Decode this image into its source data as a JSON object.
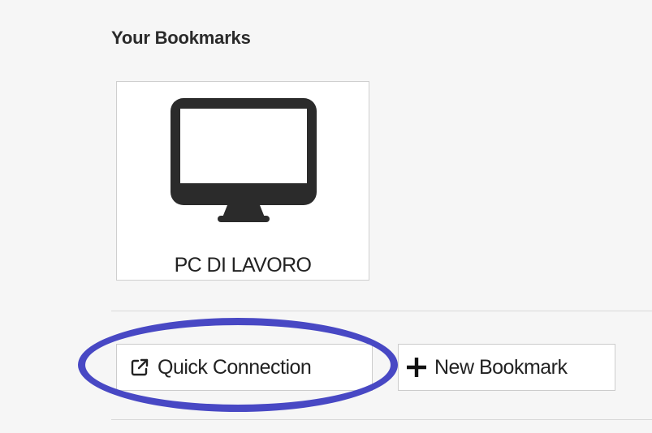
{
  "bookmarks": {
    "title": "Your Bookmarks",
    "items": [
      {
        "label": "PC DI LAVORO",
        "icon": "monitor-icon"
      }
    ]
  },
  "actions": {
    "quick_connection": {
      "label": "Quick Connection",
      "icon": "external-link-icon"
    },
    "new_bookmark": {
      "label": "New Bookmark",
      "icon": "plus-icon"
    }
  },
  "annotation": {
    "highlight_color": "#4848c4"
  }
}
